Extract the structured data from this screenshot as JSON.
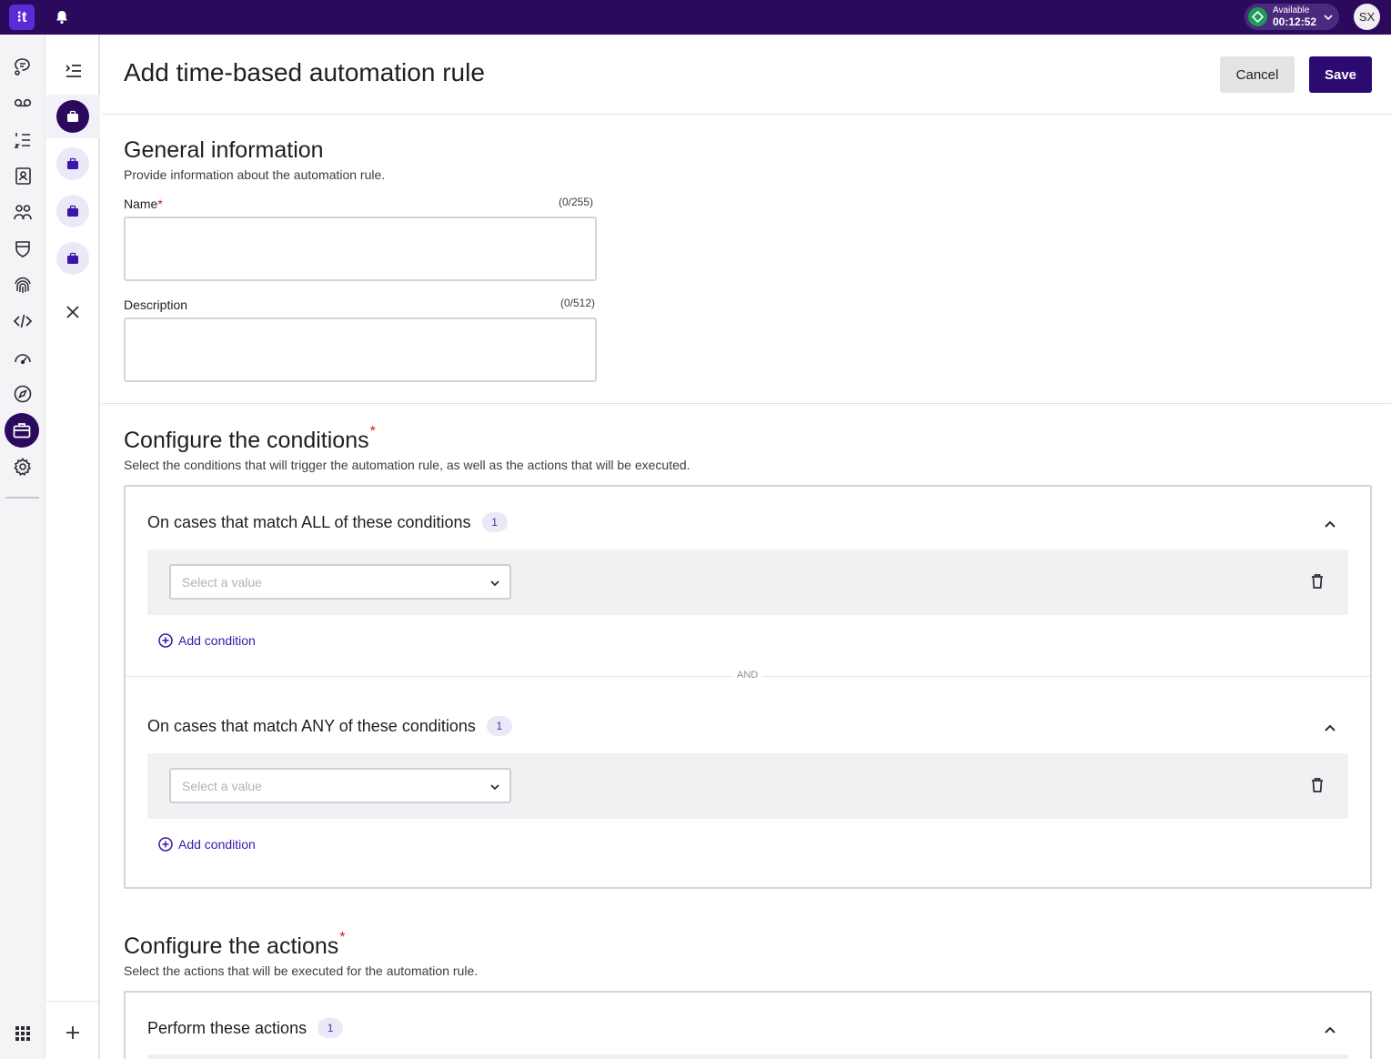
{
  "topbar": {
    "logo_text": "⁝t",
    "status": {
      "label": "Available",
      "timer": "00:12:52",
      "color": "#1c9b58"
    },
    "avatar_initials": "SX"
  },
  "leftnav": {
    "icons": [
      "chat-icon",
      "voicemail-icon",
      "list-icon",
      "contacts-icon",
      "people-icon",
      "shield-icon",
      "fingerprint-icon",
      "code-icon",
      "gauge-icon",
      "compass-icon",
      "briefcase-icon",
      "gear-icon"
    ],
    "active": "briefcase-icon",
    "bottom_icon": "apps-grid-icon"
  },
  "page": {
    "title": "Add time-based automation rule",
    "cancel_label": "Cancel",
    "save_label": "Save"
  },
  "general": {
    "title": "General information",
    "subtitle": "Provide information about the automation rule.",
    "name_label": "Name",
    "name_required": "*",
    "name_count": "(0/255)",
    "description_label": "Description",
    "description_count": "(0/512)"
  },
  "conditions": {
    "title": "Configure the conditions",
    "required": "*",
    "subtitle": "Select the conditions that will trigger the automation rule, as well as the actions that will be executed.",
    "all_group": {
      "title": "On cases that match ALL of these conditions",
      "count": "1",
      "placeholder": "Select a value",
      "add_label": "Add condition"
    },
    "and_label": "AND",
    "any_group": {
      "title": "On cases that match ANY of these conditions",
      "count": "1",
      "placeholder": "Select a value",
      "add_label": "Add condition"
    }
  },
  "actions": {
    "title": "Configure the actions",
    "required": "*",
    "subtitle": "Select the actions that will be executed for the automation rule.",
    "group": {
      "title": "Perform these actions",
      "count": "1"
    }
  },
  "colors": {
    "brand_dark": "#2b0a5e",
    "accent": "#3b16a8",
    "required": "#d21b1b"
  }
}
